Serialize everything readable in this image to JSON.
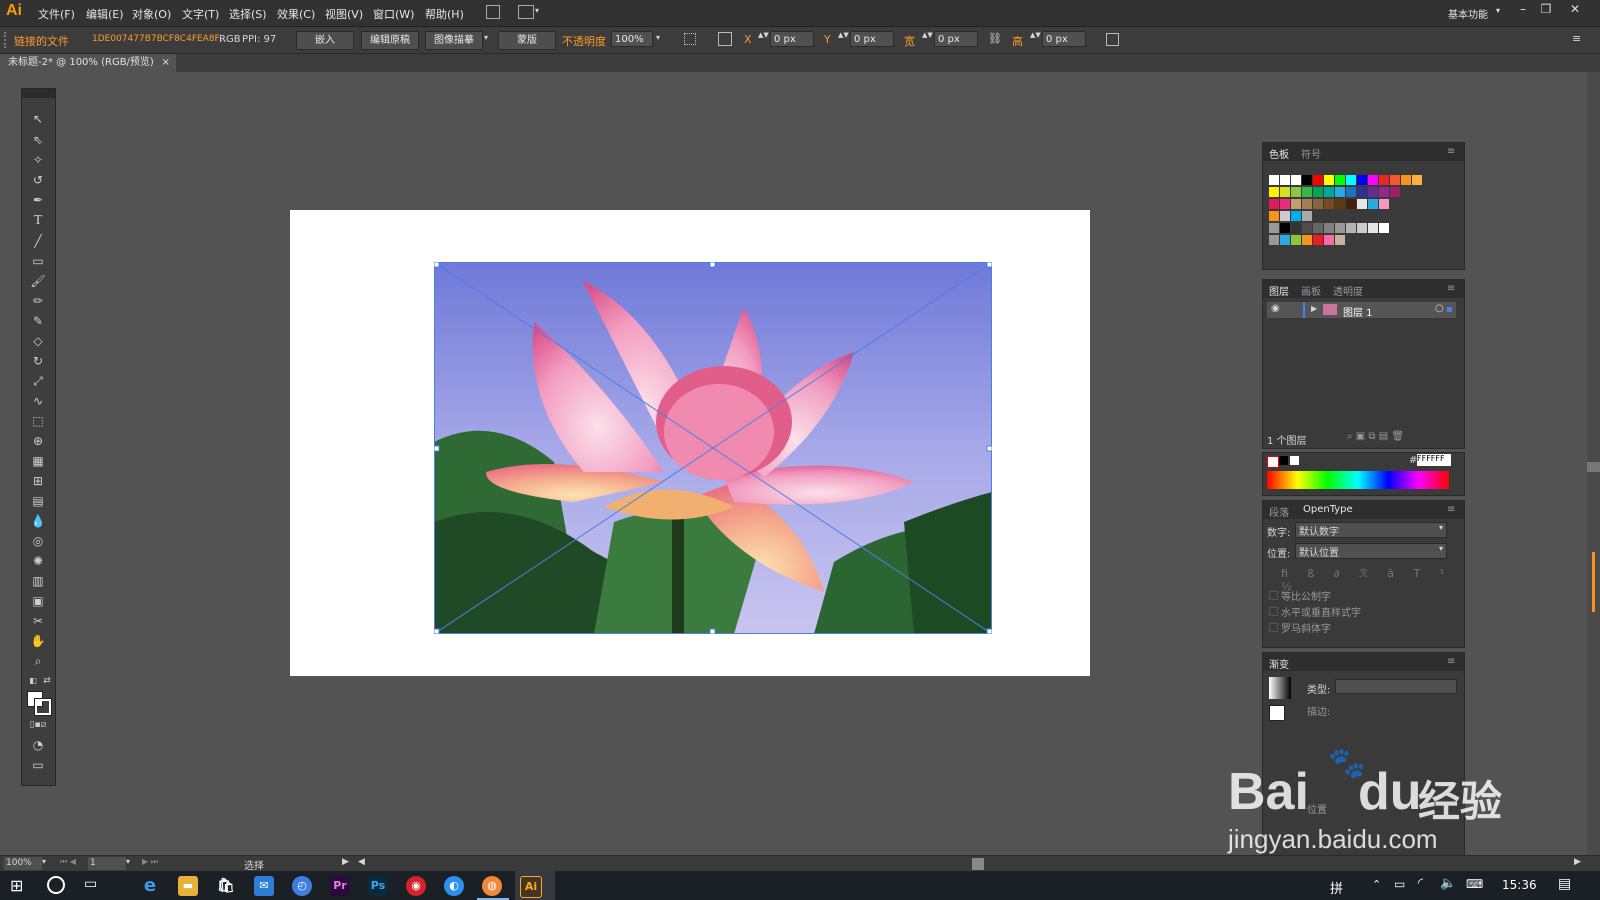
{
  "app": {
    "logo": "Ai",
    "workspace": "基本功能"
  },
  "menu": [
    "文件(F)",
    "编辑(E)",
    "对象(O)",
    "文字(T)",
    "选择(S)",
    "效果(C)",
    "视图(V)",
    "窗口(W)",
    "帮助(H)"
  ],
  "control": {
    "linked_file": "链接的文件",
    "file_id": "1DE007477B7BCF8C4FEA8F…",
    "color_mode": "RGB",
    "ppi": "PPI: 97",
    "embed": "嵌入",
    "edit_original": "编辑原稿",
    "image_trace": "图像描摹",
    "mask": "蒙版",
    "opacity_label": "不透明度",
    "opacity_value": "100%",
    "x_label": "X",
    "x_value": "0 px",
    "y_label": "Y",
    "y_value": "0 px",
    "w_label": "宽",
    "w_value": "0 px",
    "h_label": "高",
    "h_value": "0 px"
  },
  "doc_tab": {
    "title": "未标题-2* @ 100% (RGB/预览)",
    "close": "×"
  },
  "swatches_panel": {
    "tabs": [
      "色板",
      "符号"
    ]
  },
  "layers_panel": {
    "tabs": [
      "图层",
      "画板",
      "透明度"
    ],
    "layer_name": "图层 1",
    "layer_count": "1 个图层"
  },
  "color_panel": {
    "hex_prefix": "#",
    "hex_value": "FFFFFF"
  },
  "opentype_panel": {
    "tabs": [
      "段落",
      "OpenType"
    ],
    "digits_label": "数字:",
    "digits_value": "默认数字",
    "position_label": "位置:",
    "position_value": "默认位置",
    "checkboxes": [
      "等比公制字",
      "水平或垂直样式字",
      "罗马斜体字"
    ]
  },
  "gradient_panel": {
    "title": "渐变",
    "type_label": "类型:",
    "stroke_label": "描边:",
    "pos_label": "位置"
  },
  "status": {
    "zoom": "100%",
    "page": "1",
    "tool": "选择"
  },
  "taskbar": {
    "ime": "拼",
    "time": "15:36"
  },
  "watermark": {
    "brand": "Bai",
    "brand2": "du",
    "suffix": "经验",
    "url": "jingyan.baidu.com"
  },
  "colors": {
    "accent": "#ff9a00",
    "selection": "#4a7fe8"
  }
}
